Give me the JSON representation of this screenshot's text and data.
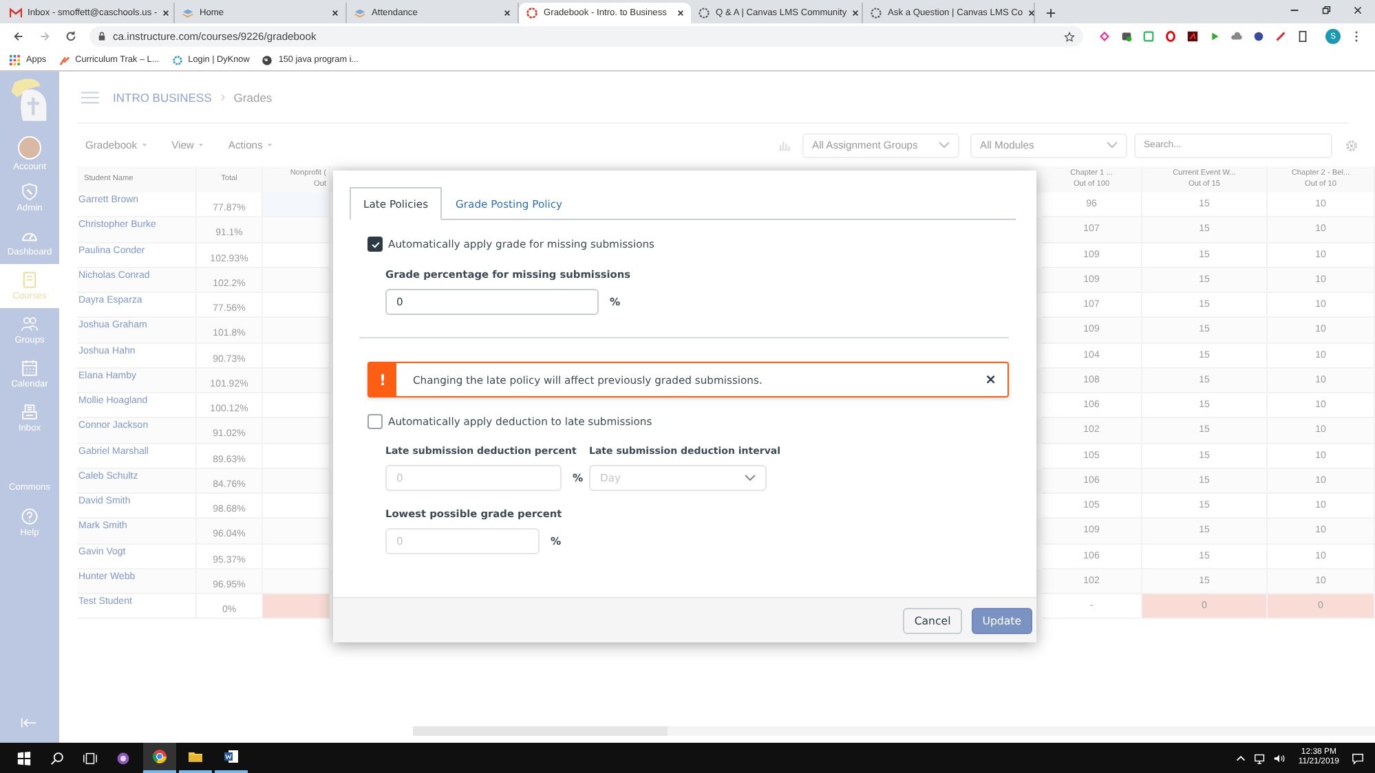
{
  "browser": {
    "tabs": [
      {
        "title": "Inbox - smoffett@caschools.us -",
        "kind": "mail",
        "selected": false
      },
      {
        "title": "Home",
        "kind": "stack",
        "selected": false
      },
      {
        "title": "Attendance",
        "kind": "stack",
        "selected": false
      },
      {
        "title": "Gradebook - Intro. to Business",
        "kind": "ring",
        "selected": true
      },
      {
        "title": "Q & A | Canvas LMS Community",
        "kind": "dots",
        "selected": false
      },
      {
        "title": "Ask a Question | Canvas LMS Co",
        "kind": "dots",
        "selected": false
      }
    ],
    "url": "ca.instructure.com/courses/9226/gradebook",
    "avatar": "S",
    "bookmarks": [
      {
        "label": "Apps",
        "kind": "grid"
      },
      {
        "label": "Curriculum Trak – L...",
        "kind": "spark"
      },
      {
        "label": "Login | DyKnow",
        "kind": "gear"
      },
      {
        "label": "150 java program i...",
        "kind": "globe"
      }
    ]
  },
  "sidebar": {
    "items": [
      {
        "label": "Account",
        "kind": "avatar",
        "selected": false
      },
      {
        "label": "Admin",
        "kind": "shield",
        "selected": false
      },
      {
        "label": "Dashboard",
        "kind": "gauge",
        "selected": false
      },
      {
        "label": "Courses",
        "kind": "book",
        "selected": true
      },
      {
        "label": "Groups",
        "kind": "people",
        "selected": false
      },
      {
        "label": "Calendar",
        "kind": "calendar",
        "selected": false
      },
      {
        "label": "Inbox",
        "kind": "inbox",
        "selected": false
      },
      {
        "label": "Commons",
        "kind": "none",
        "selected": false
      },
      {
        "label": "Help",
        "kind": "help",
        "selected": false
      }
    ]
  },
  "header": {
    "course": "INTRO BUSINESS",
    "page": "Grades"
  },
  "toolbar": {
    "menus": [
      "Gradebook",
      "View",
      "Actions"
    ],
    "filters": [
      "All Assignment Groups",
      "All Modules"
    ],
    "search": {
      "placeholder": "Search..."
    }
  },
  "table": {
    "columns": [
      {
        "name": "Student Name"
      },
      {
        "name": "Total"
      },
      {
        "name": "Nonprofit (",
        "sub": "Out"
      },
      {
        "name": "Chapter 1 ...",
        "sub": "Out of 100"
      },
      {
        "name": "Current Event W...",
        "sub": "Out of 15"
      },
      {
        "name": "Chapter 2 - Bel...",
        "sub": "Out of 10"
      }
    ],
    "rows": [
      {
        "student": "Garrett Brown",
        "total": "77.87%",
        "chapter_1": "96",
        "current_event": "15",
        "chapter_2": "10",
        "missing": false
      },
      {
        "student": "Christopher Burke",
        "total": "91.1%",
        "chapter_1": "107",
        "current_event": "15",
        "chapter_2": "10",
        "missing": false
      },
      {
        "student": "Paulina Conder",
        "total": "102.93%",
        "chapter_1": "109",
        "current_event": "15",
        "chapter_2": "10",
        "missing": false
      },
      {
        "student": "Nicholas Conrad",
        "total": "102.2%",
        "chapter_1": "109",
        "current_event": "15",
        "chapter_2": "10",
        "missing": false
      },
      {
        "student": "Dayra Esparza",
        "total": "77.56%",
        "chapter_1": "107",
        "current_event": "15",
        "chapter_2": "10",
        "missing": false
      },
      {
        "student": "Joshua Graham",
        "total": "101.8%",
        "chapter_1": "109",
        "current_event": "15",
        "chapter_2": "10",
        "missing": false
      },
      {
        "student": "Joshua Hahn",
        "total": "90.73%",
        "chapter_1": "104",
        "current_event": "15",
        "chapter_2": "10",
        "missing": false
      },
      {
        "student": "Elana Hamby",
        "total": "101.92%",
        "chapter_1": "108",
        "current_event": "15",
        "chapter_2": "10",
        "missing": false
      },
      {
        "student": "Mollie Hoagland",
        "total": "100.12%",
        "chapter_1": "106",
        "current_event": "15",
        "chapter_2": "10",
        "missing": false
      },
      {
        "student": "Connor Jackson",
        "total": "91.02%",
        "chapter_1": "102",
        "current_event": "15",
        "chapter_2": "10",
        "missing": false
      },
      {
        "student": "Gabriel Marshall",
        "total": "89.63%",
        "chapter_1": "105",
        "current_event": "15",
        "chapter_2": "10",
        "missing": false
      },
      {
        "student": "Caleb Schultz",
        "total": "84.76%",
        "chapter_1": "106",
        "current_event": "15",
        "chapter_2": "10",
        "missing": false
      },
      {
        "student": "David Smith",
        "total": "98.68%",
        "chapter_1": "105",
        "current_event": "15",
        "chapter_2": "10",
        "missing": false
      },
      {
        "student": "Mark Smith",
        "total": "96.04%",
        "chapter_1": "109",
        "current_event": "15",
        "chapter_2": "10",
        "missing": false
      },
      {
        "student": "Gavin Vogt",
        "total": "95.37%",
        "chapter_1": "106",
        "current_event": "15",
        "chapter_2": "10",
        "missing": false
      },
      {
        "student": "Hunter Webb",
        "total": "96.95%",
        "chapter_1": "102",
        "current_event": "15",
        "chapter_2": "10",
        "missing": false
      },
      {
        "student": "Test Student",
        "total": "0%",
        "chapter_1": "-",
        "current_event": "0",
        "chapter_2": "0",
        "missing": true
      }
    ]
  },
  "dialog": {
    "tabs": [
      {
        "label": "Late Policies",
        "selected": true
      },
      {
        "label": "Grade Posting Policy",
        "selected": false
      }
    ],
    "missing": {
      "label": "Automatically apply grade for missing submissions",
      "checked": true,
      "field_label": "Grade percentage for missing submissions",
      "value": "0",
      "unit": "%"
    },
    "alert": {
      "icon": "!",
      "message": "Changing the late policy will affect previously graded submissions.",
      "close": "×"
    },
    "late": {
      "label": "Automatically apply deduction to late submissions",
      "checked": false,
      "percent_label": "Late submission deduction percent",
      "percent_placeholder": "0",
      "percent_unit": "%",
      "interval_label": "Late submission deduction interval",
      "interval_value": "Day",
      "lowest_label": "Lowest possible grade percent",
      "lowest_placeholder": "0",
      "lowest_unit": "%"
    },
    "buttons": [
      {
        "label": "Cancel",
        "kind": "secondary"
      },
      {
        "label": "Update",
        "kind": "primary"
      }
    ]
  },
  "taskbar": {
    "time": "12:38 PM",
    "date": "11/21/2019"
  }
}
